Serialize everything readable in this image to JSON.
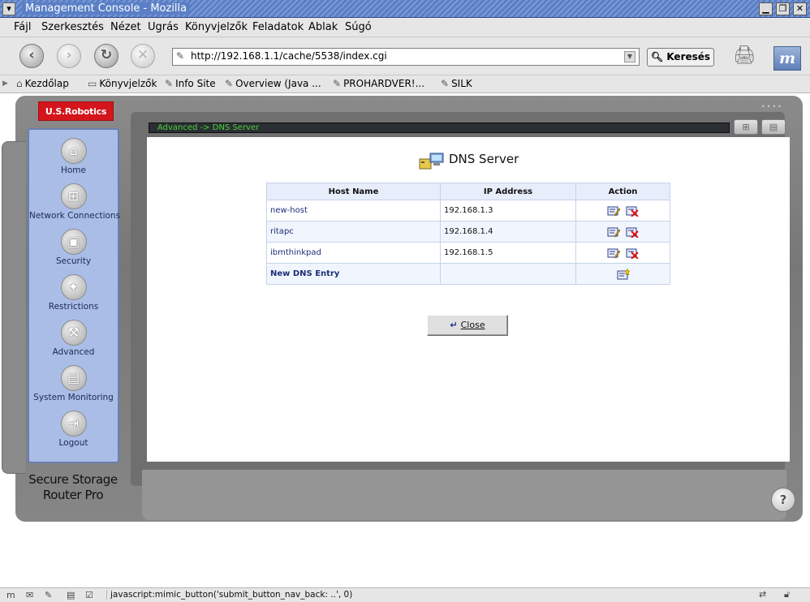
{
  "window": {
    "title": "Management Console - Mozilla"
  },
  "menu": [
    "Fájl",
    "Szerkesztés",
    "Nézet",
    "Ugrás",
    "Könyvjelzők",
    "Feladatok",
    "Ablak",
    "Súgó"
  ],
  "navigation": {
    "url": "http://192.168.1.1/cache/5538/index.cgi",
    "search_label": "Keresés"
  },
  "bookmarks": [
    {
      "label": "Kezdőlap",
      "icon": "home-icon"
    },
    {
      "label": "Könyvjelzők",
      "icon": "folder-icon"
    },
    {
      "label": "Info Site",
      "icon": "bookmark-icon"
    },
    {
      "label": "Overview (Java ...",
      "icon": "bookmark-icon"
    },
    {
      "label": "PROHARDVER!...",
      "icon": "bookmark-icon"
    },
    {
      "label": "SILK",
      "icon": "bookmark-icon"
    }
  ],
  "router": {
    "brand": "U.S.Robotics",
    "product_line1": "Secure Storage",
    "product_line2": "Router Pro",
    "breadcrumb": "Advanced -> DNS Server",
    "sidebar": [
      {
        "label": "Home",
        "icon": "home-icon"
      },
      {
        "label": "Network Connections",
        "icon": "network-icon"
      },
      {
        "label": "Security",
        "icon": "lock-icon"
      },
      {
        "label": "Restrictions",
        "icon": "restriction-icon"
      },
      {
        "label": "Advanced",
        "icon": "tools-icon"
      },
      {
        "label": "System Monitoring",
        "icon": "monitor-icon"
      },
      {
        "label": "Logout",
        "icon": "logout-icon"
      }
    ]
  },
  "dns": {
    "title": "DNS Server",
    "columns": [
      "Host Name",
      "IP Address",
      "Action"
    ],
    "rows": [
      {
        "host": "new-host",
        "ip": "192.168.1.3"
      },
      {
        "host": "ritapc",
        "ip": "192.168.1.4"
      },
      {
        "host": "ibmthinkpad",
        "ip": "192.168.1.5"
      }
    ],
    "new_entry_label": "New DNS Entry",
    "close_label": "Close"
  },
  "status": {
    "text": "javascript:mimic_button('submit_button_nav_back: ..', 0)"
  },
  "colors": {
    "brand_red": "#d4151c",
    "sidebar_blue": "#a9bde6",
    "breadcrumb_green": "#47d13a",
    "title_blue": "#5a7fc6"
  }
}
